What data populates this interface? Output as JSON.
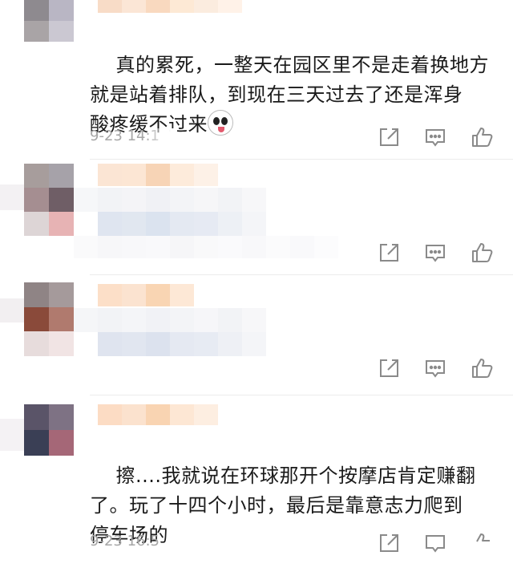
{
  "comments": [
    {
      "text": "真的累死，一整天在园区里不是走着换地方\n就是站着排队，到现在三天过去了还是浑身\n酸疼缓不过来",
      "emoji": "panda-emoji",
      "time": "9-23 14:1"
    },
    {
      "text": "",
      "time": ""
    },
    {
      "text": "",
      "time": ""
    },
    {
      "text": "擦....我就说在环球那开个按摩店肯定赚翻\n了。玩了十四个小时，最后是靠意志力爬到\n停车场的",
      "time": "9-23 16:5"
    }
  ],
  "icons": {
    "share": "share-icon",
    "comment": "comment-icon",
    "like": "like-icon"
  },
  "colors": {
    "text": "#1a1a1a",
    "meta": "#a6a6a6",
    "icon": "#8a8a8a"
  }
}
